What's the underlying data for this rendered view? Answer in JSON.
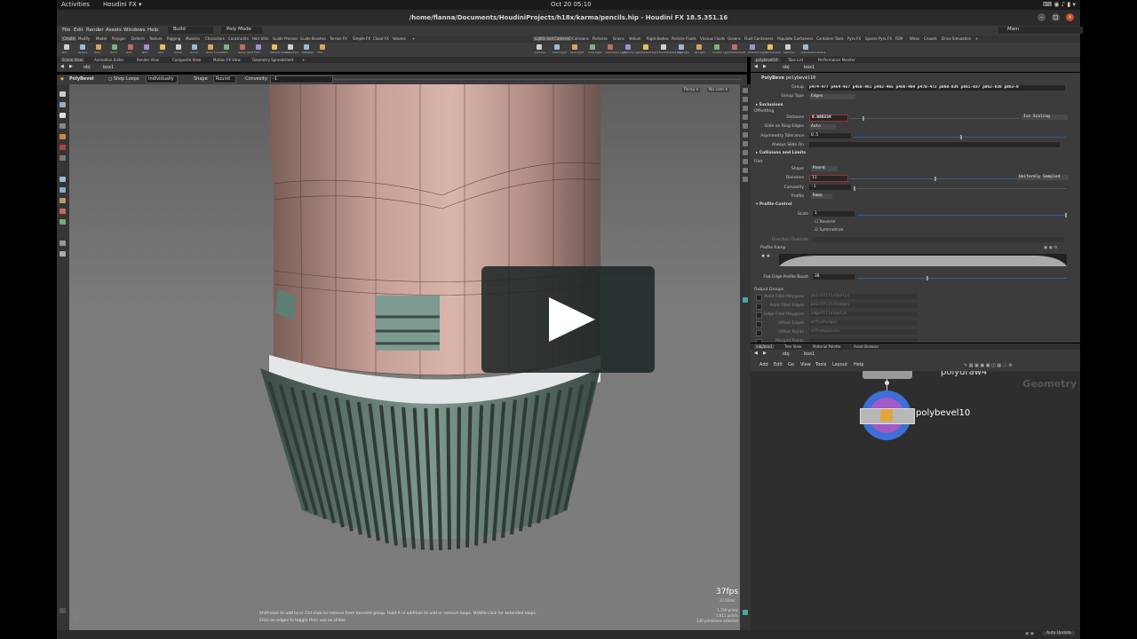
{
  "os": {
    "activities": "Activities",
    "app": "Houdini FX",
    "datetime": "Oct 20  05:10"
  },
  "window": {
    "title": "/home/flanna/Documents/HoudiniProjects/h18x/karma/pencils.hip - Houdini FX 18.5.351.16"
  },
  "menu": {
    "items": [
      "File",
      "Edit",
      "Render",
      "Assets",
      "Windows",
      "Help"
    ],
    "build": "Build",
    "mode": "Poly Mode",
    "desktop": "Main"
  },
  "shelf": {
    "left_tabs": [
      "Create",
      "Modify",
      "Model",
      "Polygon",
      "Deform",
      "Texture",
      "Rigging",
      "Muscles",
      "Characters",
      "Constraints",
      "Hair Utils",
      "Guide Process",
      "Guide Brushes",
      "Terrain FX",
      "Simple FX",
      "Cloud FX",
      "Volume"
    ],
    "right_tabs": [
      "Lights and Cameras",
      "Collisions",
      "Particles",
      "Grains",
      "Vellum",
      "Rigid Bodies",
      "Particle Fluids",
      "Viscous Fluids",
      "Oceans",
      "Fluid Containers",
      "Populate Containers",
      "Container Tools",
      "Pyro FX",
      "Sparse Pyro FX",
      "FEM",
      "Wires",
      "Crowds",
      "Drive Simulation"
    ],
    "left_icons": [
      "Box",
      "Sphere",
      "Tube",
      "Torus",
      "Grid",
      "Null",
      "Line",
      "Circle",
      "Curve",
      "Draw Curve",
      "Path",
      "Spray Paint",
      "Font",
      "Platonic Solids",
      "L-System",
      "Metaball",
      "File"
    ],
    "right_icons": [
      "Camera",
      "Point Light",
      "Spot Light",
      "Area Light",
      "Geometry Light",
      "Volume Light",
      "Distant Light",
      "Environment Light",
      "Sky Light",
      "GI Light",
      "Caustic Light",
      "Portal Light",
      "Ambient Light",
      "VR Camera",
      "Switcher",
      "Gamepad Camera"
    ]
  },
  "left_pane": {
    "tabs": [
      "Scene View",
      "Animation Editor",
      "Render View",
      "Composite View",
      "Motion FX View",
      "Geometry Spreadsheet"
    ],
    "path": [
      "obj",
      "box1"
    ]
  },
  "tool_options": {
    "tool": "PolyBevel",
    "shop_loops": "Shop Loops",
    "mode": "Individually",
    "shape_label": "Shape",
    "shape_value": "Round",
    "convexity_label": "Convexity",
    "convexity_value": "-1"
  },
  "viewport": {
    "persp": "Persp ▾",
    "cam": "No cam ▾",
    "fps": "37fps",
    "time": "27.03ms",
    "stats": [
      "1,159  prims",
      "1,611  points",
      "330 primitives selected"
    ],
    "hints": [
      "Shift-click to add to or Ctrl-click to remove from beveled group.  Hold A in addition to add or remove loops.  Middle-click for extended loops.",
      "Click on edges to toggle their use as slides."
    ]
  },
  "param_pane": {
    "tabs": [
      "polybevel10",
      "Take List",
      "Performance Monitor"
    ],
    "path": [
      "obj",
      "box1"
    ],
    "node_type": "PolyBevel",
    "node_name": "polybevel10",
    "group_label": "Group",
    "group_value": "p474-477 p454-457 p458-461 p462-465 p466-469 p470-473 p860-836 p861-837 p862-838 p863-8",
    "group_type_label": "Group Type",
    "group_type_value": "Edges",
    "exclusions": "Exclusions",
    "offsetting": "Offsetting",
    "distance_label": "Distance",
    "distance_value": "0.086334",
    "distance_mode": "Iso Scaling",
    "slide_label": "Slide on Ring Edges",
    "slide_value": "Auto",
    "asym_label": "Asymmetry Tolerance",
    "asym_value": "0.5",
    "always_slide": "Always Slide On",
    "collisions": "Collisions and Limits",
    "filet": "Filet",
    "shape_label": "Shape",
    "shape_value": "Round",
    "divisions_label": "Divisions",
    "divisions_value": "11",
    "divisions_mode": "Uniformly Sampled",
    "convexity_label": "Convexity",
    "convexity_value": "-1",
    "profile_label": "Profile",
    "profile_value": "Ramp",
    "profile_control": "Profile Control",
    "scale_label": "Scale",
    "scale_value": "1",
    "reverse": "Reverse",
    "symmetrize": "Symmetrize",
    "direction_override": "Direction Override",
    "profile_ramp": "Profile Ramp",
    "flat_boost_label": "Flat Edge Profile Boost",
    "flat_boost_value": "30",
    "output_groups": "Output Groups",
    "outputs": [
      {
        "label": "Point Fillet Polygons",
        "value": "pointfilletpolys"
      },
      {
        "label": "Point Fillet Edges",
        "value": "pointfilletedges"
      },
      {
        "label": "Edge Fillet Polygons",
        "value": "edgefilletpolys"
      },
      {
        "label": "Offset Edges",
        "value": "offsetedges"
      },
      {
        "label": "Offset Points",
        "value": "offsetpoints"
      },
      {
        "label": "Merged Points",
        "value": ""
      }
    ]
  },
  "network_pane": {
    "tabs": [
      "/obj/box1",
      "Tree View",
      "Material Palette",
      "Asset Browser"
    ],
    "path": [
      "obj",
      "box1"
    ],
    "menu": [
      "Add",
      "Edit",
      "Go",
      "View",
      "Tools",
      "Layout",
      "Help"
    ],
    "watermark": "Geometry",
    "node_above": "polydraw4",
    "node_current": "polybevel10"
  },
  "status": {
    "auto_update": "Auto Update"
  },
  "colors": {
    "bevel_node_ring": "#3d6fd6",
    "bevel_node_inner": "#a05bc7",
    "node_icon": "#e0a63c",
    "grip_green": "#5d7f73",
    "cap_pink": "#b58a84",
    "overlay": "#1e2828"
  }
}
